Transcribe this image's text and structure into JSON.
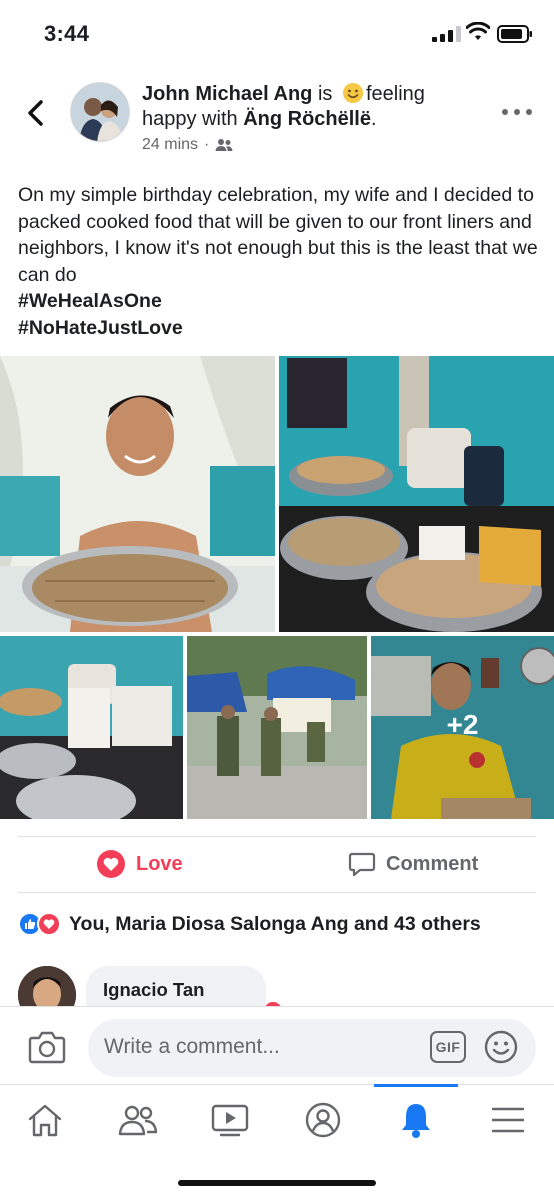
{
  "status_bar": {
    "time": "3:44"
  },
  "post": {
    "author": "John Michael Ang",
    "feeling_prefix": " is ",
    "feeling_text": "feeling happy",
    "with_text": " with ",
    "tagged_user": "Äng Röchëllë",
    "tag_end": ".",
    "time": "24 mins",
    "meta_separator": "·",
    "audience_icon": "friends-icon",
    "body": "On my simple birthday celebration, my wife and I decided to packed cooked food that will be given to our front liners and neighbors, I know it's not enough but this is the least that we can do",
    "hashtags": [
      "#WeHealAsOne",
      "#NoHateJustLove"
    ],
    "more_photos": "+2"
  },
  "actions": {
    "love_label": "Love",
    "comment_label": "Comment",
    "love_color": "#f33e58",
    "like_color": "#1877f2"
  },
  "reactions": {
    "summary": "You, Maria Diosa Salonga Ang and 43 others"
  },
  "comment_preview": {
    "name": "Ignacio Tan"
  },
  "composer": {
    "placeholder": "Write a comment...",
    "gif_label": "GIF"
  },
  "tab_bar": {
    "items": [
      "home-icon",
      "friends-icon",
      "watch-icon",
      "profile-icon",
      "notifications-icon",
      "menu-icon"
    ],
    "active": "notifications-icon"
  }
}
